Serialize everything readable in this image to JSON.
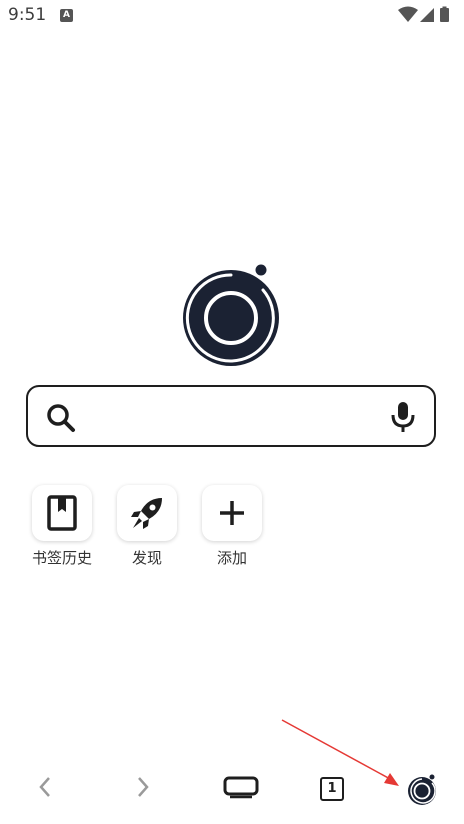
{
  "status_bar": {
    "time": "9:51",
    "notification_badge": "A"
  },
  "search": {
    "placeholder": ""
  },
  "shortcuts": [
    {
      "label": "书签历史",
      "icon": "bookmark-icon"
    },
    {
      "label": "发现",
      "icon": "rocket-icon"
    },
    {
      "label": "添加",
      "icon": "plus-icon"
    }
  ],
  "bottom_nav": {
    "tab_count": "1"
  }
}
